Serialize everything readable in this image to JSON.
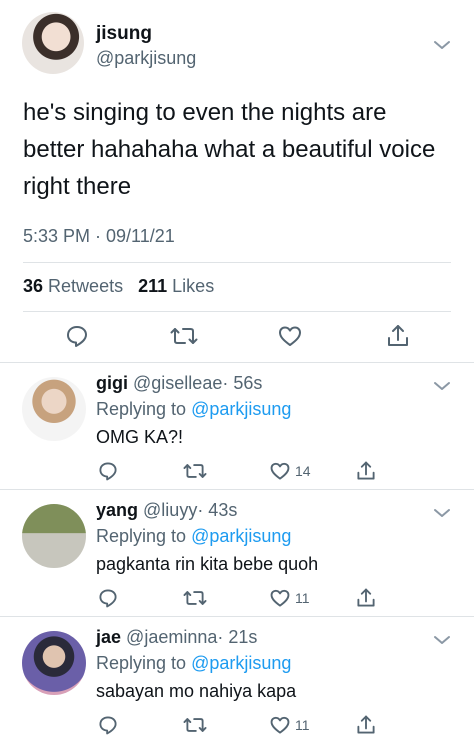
{
  "main_tweet": {
    "name": "jisung",
    "handle": "@parkjisung",
    "text": "he's singing to even the nights are better hahahaha what a beautiful voice right there",
    "timestamp": "5:33 PM · 09/11/21",
    "retweets_count": "36",
    "retweets_label": "Retweets",
    "likes_count": "211",
    "likes_label": "Likes",
    "actions": [
      "reply-icon",
      "retweet-icon",
      "like-icon",
      "share-icon"
    ]
  },
  "replies": [
    {
      "name": "gigi",
      "handle": "@giselleae",
      "time": "· 56s",
      "replying_prefix": "Replying to",
      "replying_to": "@parkjisung",
      "text": "OMG KA?!",
      "like_count": "14"
    },
    {
      "name": "yang",
      "handle": "@liuyy",
      "time": "· 43s",
      "replying_prefix": "Replying to",
      "replying_to": "@parkjisung",
      "text": "pagkanta rin kita bebe quoh",
      "like_count": "11"
    },
    {
      "name": "jae",
      "handle": "@jaeminna",
      "time": "· 21s",
      "replying_prefix": "Replying to",
      "replying_to": "@parkjisung",
      "text": "sabayan mo nahiya kapa",
      "like_count": "11"
    }
  ],
  "colors": {
    "accent": "#1d9bf0",
    "secondary_text": "#536471",
    "divider": "#dfe3e6"
  }
}
